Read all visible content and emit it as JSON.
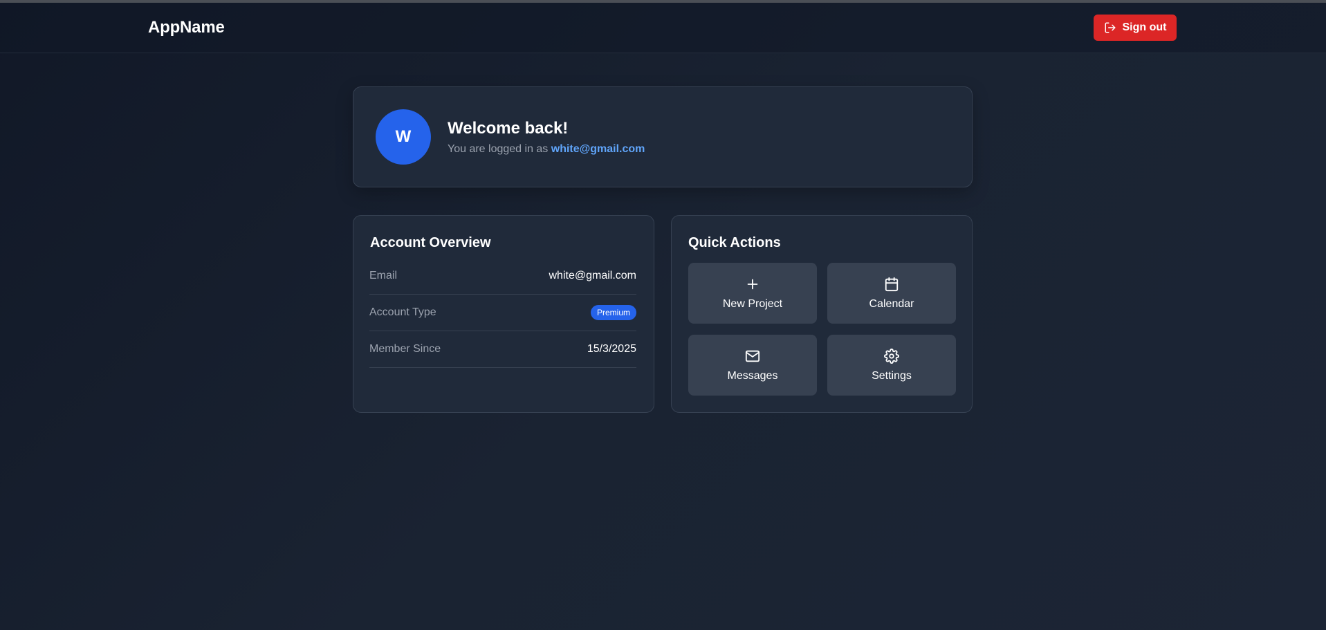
{
  "app": {
    "brand": "AppName"
  },
  "header": {
    "signout_label": "Sign out",
    "signout_color": "#dc2626"
  },
  "welcome": {
    "avatar_initial": "W",
    "title": "Welcome back!",
    "subtitle_prefix": "You are logged in as",
    "email": "white@gmail.com",
    "accent_color": "#2563eb"
  },
  "account_overview": {
    "title": "Account Overview",
    "rows": [
      {
        "label": "Email",
        "value": "white@gmail.com"
      },
      {
        "label": "Account Type",
        "value": "Premium",
        "type": "badge"
      },
      {
        "label": "Member Since",
        "value": "15/3/2025"
      }
    ]
  },
  "quick_actions": {
    "title": "Quick Actions",
    "items": [
      {
        "label": "New Project",
        "icon": "plus-icon"
      },
      {
        "label": "Calendar",
        "icon": "calendar-icon"
      },
      {
        "label": "Messages",
        "icon": "mail-icon"
      },
      {
        "label": "Settings",
        "icon": "gear-icon"
      }
    ]
  }
}
